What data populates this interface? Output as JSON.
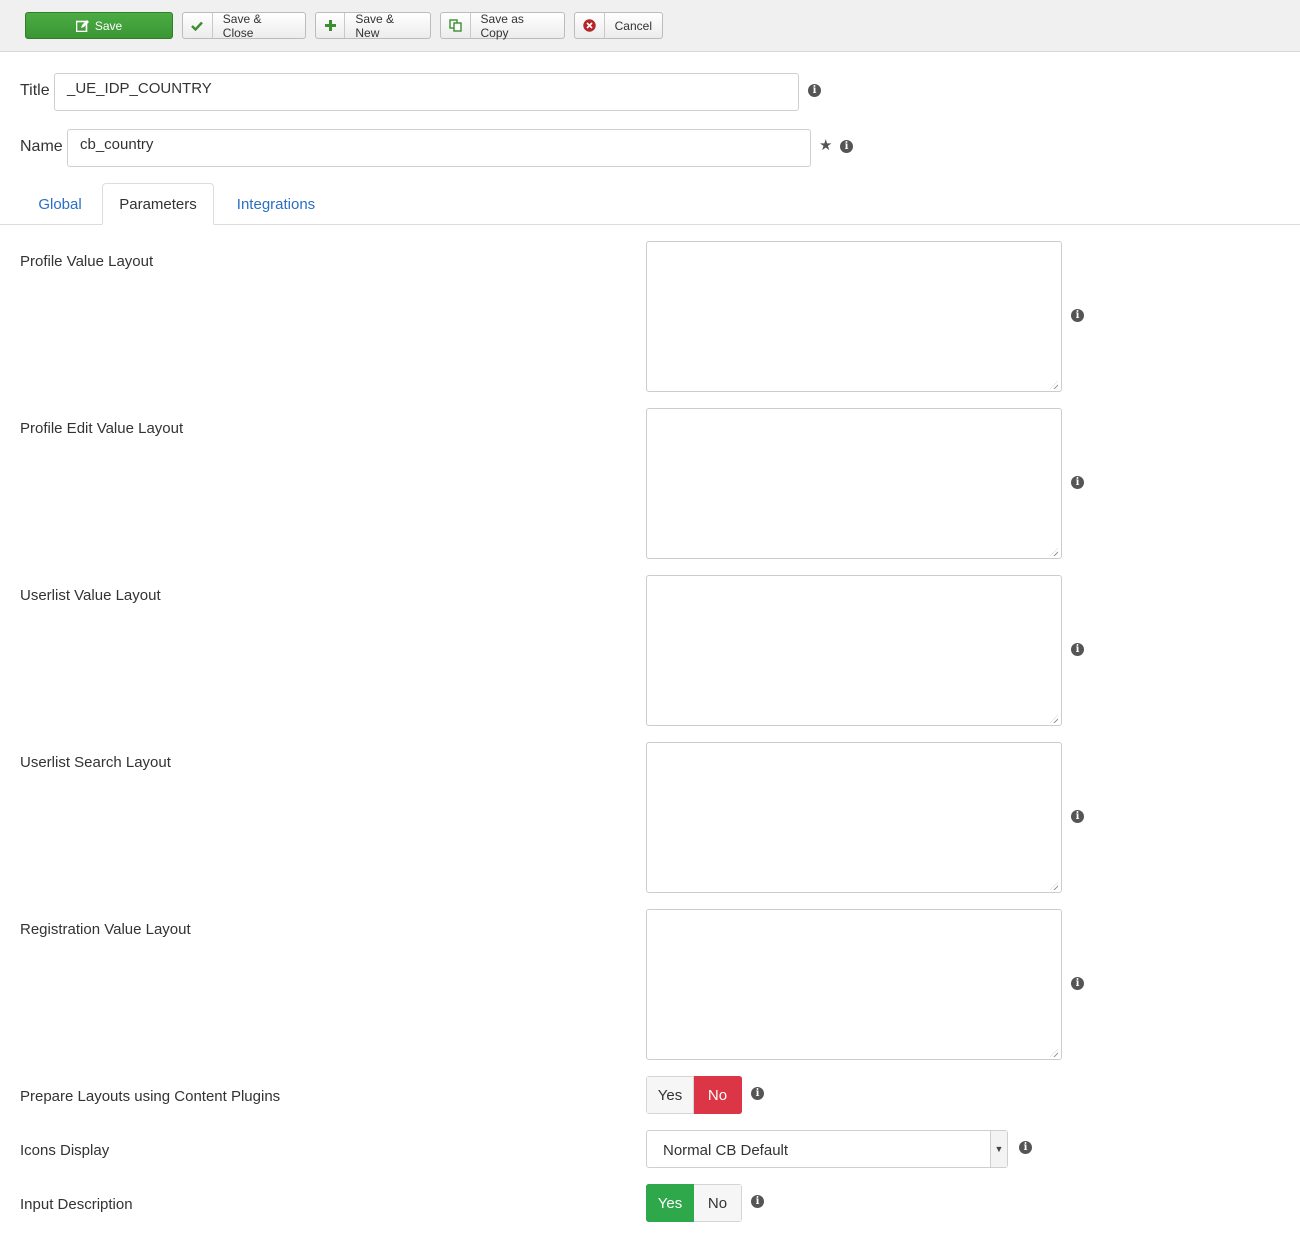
{
  "toolbar": {
    "save_label": "Save",
    "save_close_label": "Save & Close",
    "save_new_label": "Save & New",
    "save_copy_label": "Save as Copy",
    "cancel_label": "Cancel"
  },
  "form": {
    "title_label": "Title",
    "title_value": "_UE_IDP_COUNTRY",
    "name_label": "Name",
    "name_value": "cb_country"
  },
  "tabs": [
    {
      "label": "Global",
      "active": false
    },
    {
      "label": "Parameters",
      "active": true
    },
    {
      "label": "Integrations",
      "active": false
    }
  ],
  "parameters": {
    "layouts": [
      {
        "label": "Profile Value Layout",
        "value": ""
      },
      {
        "label": "Profile Edit Value Layout",
        "value": ""
      },
      {
        "label": "Userlist Value Layout",
        "value": ""
      },
      {
        "label": "Userlist Search Layout",
        "value": ""
      },
      {
        "label": "Registration Value Layout",
        "value": ""
      }
    ],
    "prepare_layouts": {
      "label": "Prepare Layouts using Content Plugins",
      "yes": "Yes",
      "no": "No",
      "selected": "No"
    },
    "icons_display": {
      "label": "Icons Display",
      "selected": "Normal CB Default"
    },
    "input_description": {
      "label": "Input Description",
      "yes": "Yes",
      "no": "No",
      "selected": "Yes"
    }
  },
  "colors": {
    "save_green": "#3a9634",
    "yes_green": "#2ea84a",
    "no_red": "#dc3545",
    "link_blue": "#2a6fc4"
  }
}
